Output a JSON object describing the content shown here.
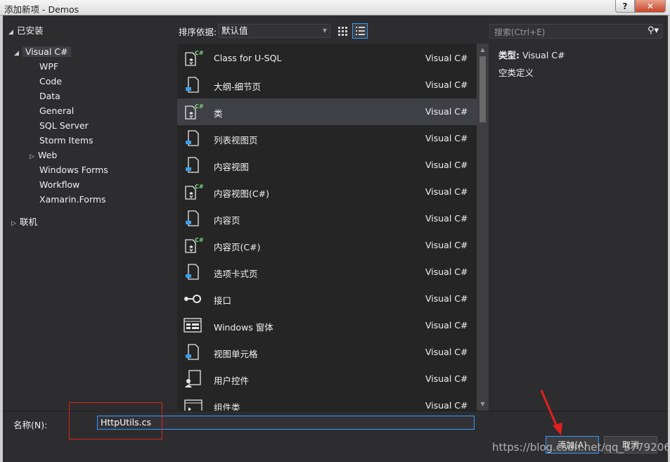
{
  "window": {
    "title": "添加新项 - Demos",
    "help_label": "?",
    "close_label": "✕"
  },
  "tree": {
    "installed_label": "已安装",
    "root_label": "Visual C#",
    "children": [
      "WPF",
      "Code",
      "Data",
      "General",
      "SQL Server",
      "Storm Items",
      "Web",
      "Windows Forms",
      "Workflow",
      "Xamarin.Forms"
    ],
    "online_label": "联机"
  },
  "toolbar": {
    "sort_label": "排序依据:",
    "sort_value": "默认值",
    "search_placeholder": "搜索(Ctrl+E)"
  },
  "templates": [
    {
      "name": "Class for U-SQL",
      "lang": "Visual C#",
      "icon": "csharp-class-icon"
    },
    {
      "name": "大纲-细节页",
      "lang": "Visual C#",
      "icon": "page-icon"
    },
    {
      "name": "类",
      "lang": "Visual C#",
      "icon": "csharp-class-icon",
      "selected": true
    },
    {
      "name": "列表视图页",
      "lang": "Visual C#",
      "icon": "page-icon"
    },
    {
      "name": "内容视图",
      "lang": "Visual C#",
      "icon": "page-icon"
    },
    {
      "name": "内容视图(C#)",
      "lang": "Visual C#",
      "icon": "csharp-class-icon"
    },
    {
      "name": "内容页",
      "lang": "Visual C#",
      "icon": "page-icon"
    },
    {
      "name": "内容页(C#)",
      "lang": "Visual C#",
      "icon": "csharp-class-icon"
    },
    {
      "name": "选项卡式页",
      "lang": "Visual C#",
      "icon": "page-icon"
    },
    {
      "name": "接口",
      "lang": "Visual C#",
      "icon": "interface-icon"
    },
    {
      "name": "Windows 窗体",
      "lang": "Visual C#",
      "icon": "form-icon"
    },
    {
      "name": "视图单元格",
      "lang": "Visual C#",
      "icon": "page-icon"
    },
    {
      "name": "用户控件",
      "lang": "Visual C#",
      "icon": "user-control-icon"
    },
    {
      "name": "组件类",
      "lang": "Visual C#",
      "icon": "component-icon"
    }
  ],
  "details": {
    "type_label": "类型:",
    "type_value": "Visual C#",
    "description": "空类定义"
  },
  "bottom": {
    "name_label": "名称(N):",
    "name_value": "HttpUtils.cs",
    "add_label": "添加(A)",
    "cancel_label": "取消"
  },
  "watermark": "https://blog.csdn.net/qq_37792061",
  "colors": {
    "background": "#2d2d30",
    "list_background": "#252526",
    "selection": "#3f3f46",
    "accent": "#3399ff",
    "annotation_red": "#e0201e"
  }
}
